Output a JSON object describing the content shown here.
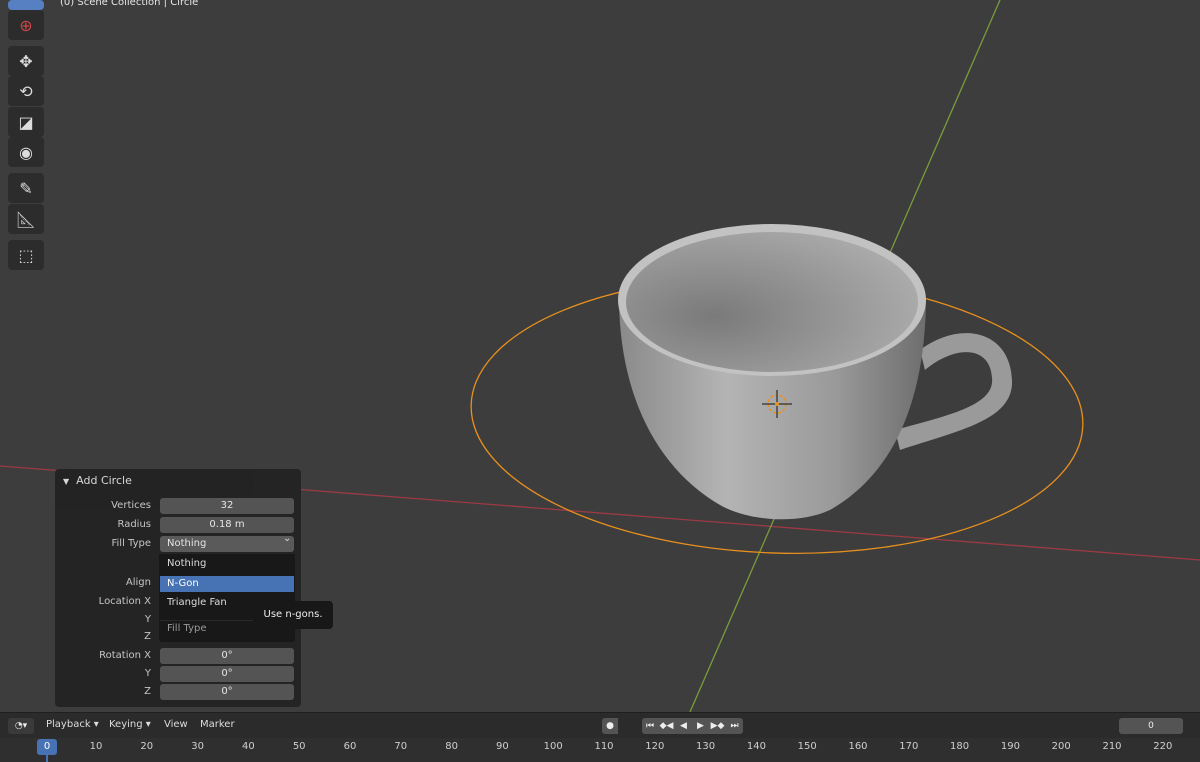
{
  "viewport": {
    "header_text": "(0) Scene Collection | Circle"
  },
  "toolbar": {
    "tools": [
      {
        "icon": "select-box-icon"
      },
      {
        "icon": "cursor-icon"
      },
      {
        "icon": "move-icon"
      },
      {
        "icon": "rotate-icon"
      },
      {
        "icon": "scale-icon"
      },
      {
        "icon": "transform-icon"
      },
      {
        "icon": "annotate-icon"
      },
      {
        "icon": "measure-icon"
      },
      {
        "icon": "add-cube-icon"
      }
    ]
  },
  "operator_panel": {
    "title": "Add Circle",
    "rows": [
      {
        "label": "Vertices",
        "value": "32"
      },
      {
        "label": "Radius",
        "value": "0.18 m"
      },
      {
        "label": "Fill Type",
        "value": "Nothing"
      },
      {
        "label": "Align",
        "value": ""
      },
      {
        "label": "Location X",
        "value": ""
      },
      {
        "label": "Y",
        "value": ""
      },
      {
        "label": "Z",
        "value": ""
      },
      {
        "label": "Rotation X",
        "value": "0°"
      },
      {
        "label": "Y",
        "value": "0°"
      },
      {
        "label": "Z",
        "value": "0°"
      }
    ]
  },
  "dropdown": {
    "options": [
      "Nothing",
      "N-Gon",
      "Triangle Fan"
    ],
    "selected": "N-Gon",
    "footer": "Fill Type"
  },
  "tooltip": "Use n-gons.",
  "timeline": {
    "menus": [
      "Playback",
      "Keying",
      "View",
      "Marker"
    ],
    "current_frame": "0",
    "frame_field": "0",
    "ticks": [
      "10",
      "20",
      "30",
      "40",
      "50",
      "60",
      "70",
      "80",
      "90",
      "100",
      "110",
      "120",
      "130",
      "140",
      "150",
      "160",
      "170",
      "180",
      "190",
      "200",
      "210",
      "220"
    ]
  },
  "colors": {
    "accent": "#4772b3",
    "selection_orange": "#e8901e",
    "x_axis": "#9c3a44",
    "y_axis": "#7a9c3a"
  }
}
